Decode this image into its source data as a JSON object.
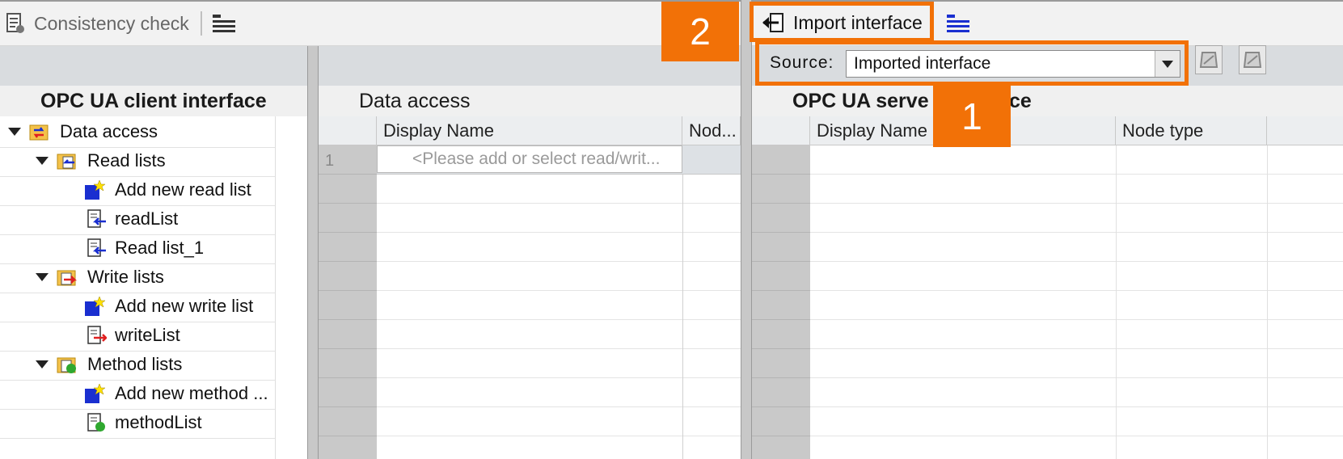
{
  "toolbar": {
    "consistency_check": "Consistency check",
    "import_interface": "Import interface"
  },
  "source": {
    "label": "Source:",
    "value": "Imported interface"
  },
  "callouts": {
    "one": "1",
    "two": "2"
  },
  "client_panel": {
    "title": "OPC UA client interface",
    "tree": [
      {
        "label": "Data access",
        "icon": "data-access-folder-icon"
      },
      {
        "label": "Read lists",
        "icon": "read-folder-icon"
      },
      {
        "label": "Add new read list",
        "icon": "add-new-icon"
      },
      {
        "label": "readList",
        "icon": "read-list-icon"
      },
      {
        "label": "Read list_1",
        "icon": "read-list-icon"
      },
      {
        "label": "Write lists",
        "icon": "write-folder-icon"
      },
      {
        "label": "Add new write list",
        "icon": "add-new-icon"
      },
      {
        "label": "writeList",
        "icon": "write-list-icon"
      },
      {
        "label": "Method lists",
        "icon": "method-folder-icon"
      },
      {
        "label": "Add new method ...",
        "icon": "add-new-icon"
      },
      {
        "label": "methodList",
        "icon": "method-list-icon"
      }
    ]
  },
  "data_access_panel": {
    "title": "Data access",
    "columns": [
      "Display Name",
      "Nod..."
    ],
    "row1_number": "1",
    "row1_placeholder": "<Please add or select read/writ..."
  },
  "server_panel": {
    "title_visible_left": "OPC UA serve",
    "title_visible_right": "ce",
    "columns": [
      "Display Name",
      "Node type"
    ]
  },
  "colors": {
    "accent": "#f27107"
  }
}
